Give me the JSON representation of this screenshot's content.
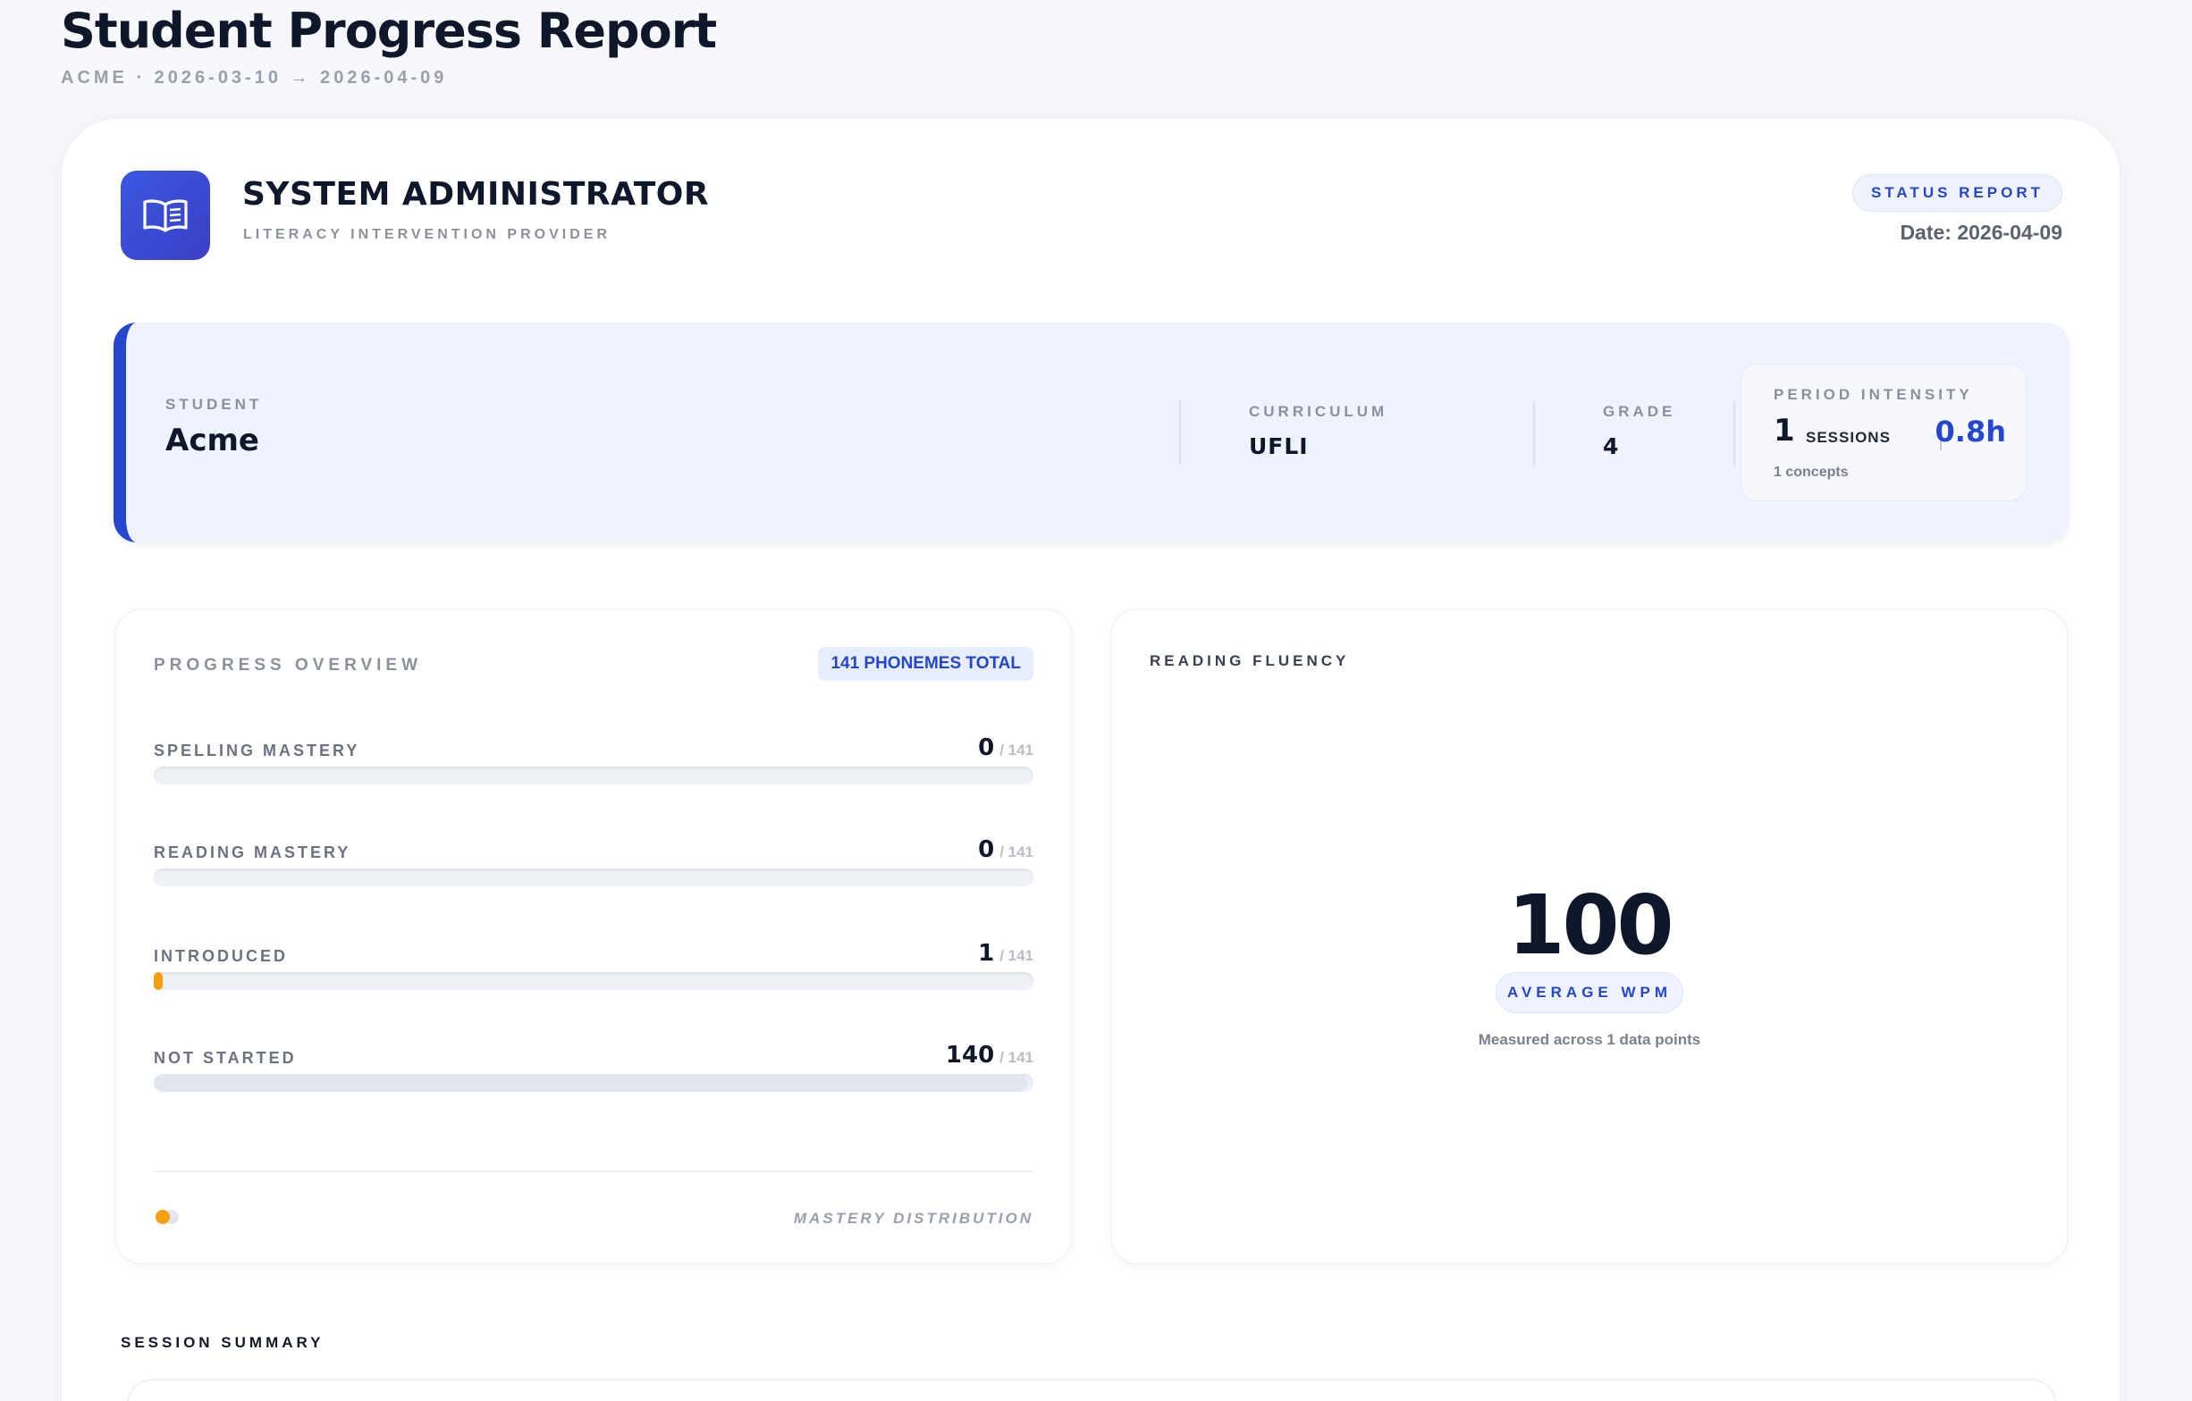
{
  "page": {
    "title": "Student Progress Report",
    "subtitle": "ACME · 2026-03-10 → 2026-04-09"
  },
  "header": {
    "logo_icon": "open-book-icon",
    "org_name": "SYSTEM ADMINISTRATOR",
    "org_role": "LITERACY INTERVENTION PROVIDER",
    "status_label": "STATUS REPORT",
    "date_label": "Date: 2026-04-09"
  },
  "student": {
    "student_label": "STUDENT",
    "student_name": "Acme",
    "curriculum_label": "CURRICULUM",
    "curriculum_value": "UFLI",
    "grade_label": "GRADE",
    "grade_value": "4",
    "intensity": {
      "label": "PERIOD INTENSITY",
      "sessions_count": "1",
      "sessions_label": "SESSIONS",
      "hours": "0.8h",
      "concepts": "1 concepts"
    }
  },
  "progress": {
    "title": "PROGRESS OVERVIEW",
    "total_badge": "141 PHONEMES TOTAL",
    "total": 141,
    "metrics": [
      {
        "label": "SPELLING MASTERY",
        "value": "0",
        "of": "/ 141",
        "fraction": 0.0,
        "color": "#22c55e"
      },
      {
        "label": "READING MASTERY",
        "value": "0",
        "of": "/ 141",
        "fraction": 0.0,
        "color": "#3b82f6"
      },
      {
        "label": "INTRODUCED",
        "value": "1",
        "of": "/ 141",
        "fraction": 0.0071,
        "color": "#f5a011"
      },
      {
        "label": "NOT STARTED",
        "value": "140",
        "of": "/ 141",
        "fraction": 0.9929,
        "color": "#e2e6ee"
      }
    ],
    "distribution_label": "MASTERY DISTRIBUTION",
    "distribution_colors": [
      "#f5a011",
      "#e2e6ee"
    ]
  },
  "fluency": {
    "title": "READING FLUENCY",
    "average_wpm": "100",
    "wpm_label": "AVERAGE WPM",
    "caption": "Measured across 1 data points"
  },
  "sessions": {
    "title": "SESSION SUMMARY"
  }
}
